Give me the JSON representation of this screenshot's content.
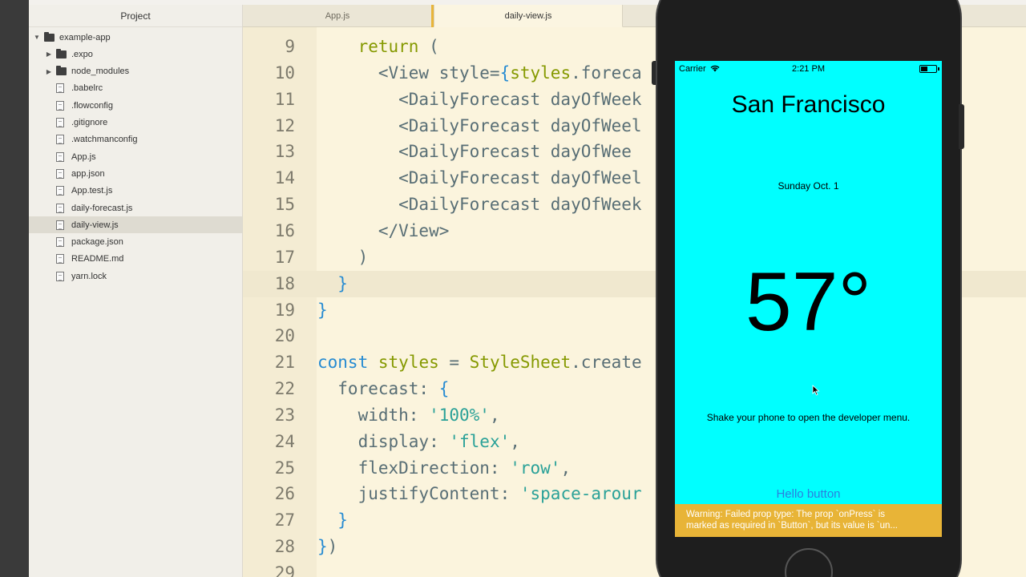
{
  "sidebar": {
    "title": "Project",
    "root": "example-app",
    "items": [
      {
        "label": ".expo",
        "type": "folder"
      },
      {
        "label": "node_modules",
        "type": "folder"
      },
      {
        "label": ".babelrc",
        "type": "file"
      },
      {
        "label": ".flowconfig",
        "type": "file"
      },
      {
        "label": ".gitignore",
        "type": "file"
      },
      {
        "label": ".watchmanconfig",
        "type": "file"
      },
      {
        "label": "App.js",
        "type": "file"
      },
      {
        "label": "app.json",
        "type": "file"
      },
      {
        "label": "App.test.js",
        "type": "file"
      },
      {
        "label": "daily-forecast.js",
        "type": "file"
      },
      {
        "label": "daily-view.js",
        "type": "file",
        "selected": true
      },
      {
        "label": "package.json",
        "type": "file"
      },
      {
        "label": "README.md",
        "type": "file"
      },
      {
        "label": "yarn.lock",
        "type": "file"
      }
    ]
  },
  "tabs": [
    {
      "label": "App.js"
    },
    {
      "label": "daily-view.js",
      "active": true
    }
  ],
  "editor": {
    "current_line": 18,
    "lines": [
      {
        "n": "9",
        "code": "    return ("
      },
      {
        "n": "10",
        "code": "      <View style={styles.foreca"
      },
      {
        "n": "11",
        "code": "        <DailyForecast dayOfWeek"
      },
      {
        "n": "12",
        "code": "        <DailyForecast dayOfWeel"
      },
      {
        "n": "13",
        "code": "        <DailyForecast dayOfWee"
      },
      {
        "n": "14",
        "code": "        <DailyForecast dayOfWeel"
      },
      {
        "n": "15",
        "code": "        <DailyForecast dayOfWeek"
      },
      {
        "n": "16",
        "code": "      </View>"
      },
      {
        "n": "17",
        "code": "    )"
      },
      {
        "n": "18",
        "code": "  }"
      },
      {
        "n": "19",
        "code": "}"
      },
      {
        "n": "20",
        "code": ""
      },
      {
        "n": "21",
        "code": "const styles = StyleSheet.create"
      },
      {
        "n": "22",
        "code": "  forecast: {"
      },
      {
        "n": "23",
        "code": "    width: '100%',"
      },
      {
        "n": "24",
        "code": "    display: 'flex',"
      },
      {
        "n": "25",
        "code": "    flexDirection: 'row',"
      },
      {
        "n": "26",
        "code": "    justifyContent: 'space-arour"
      },
      {
        "n": "27",
        "code": "  }"
      },
      {
        "n": "28",
        "code": "})"
      },
      {
        "n": "29",
        "code": ""
      }
    ]
  },
  "phone": {
    "carrier": "Carrier",
    "time": "2:21 PM",
    "city": "San Francisco",
    "date": "Sunday Oct. 1",
    "temperature": "57°",
    "dev_message": "Shake your phone to open the developer menu.",
    "button_label": "Hello button",
    "warning_line1": "Warning: Failed prop type: The prop `onPress` is",
    "warning_line2": "marked as required in `Button`, but its value is `un..."
  },
  "colors": {
    "screen_bg": "#00ffff",
    "warning_bg": "#e8b437",
    "editor_bg": "#fbf4dd"
  }
}
